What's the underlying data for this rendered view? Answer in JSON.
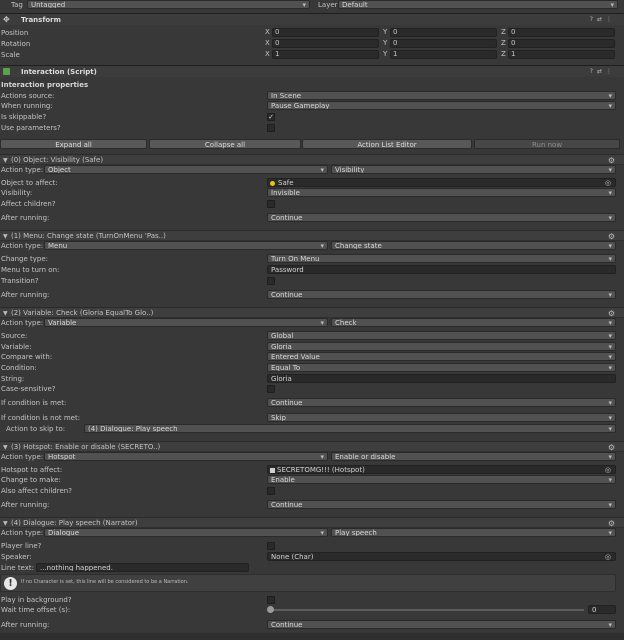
{
  "header": {
    "tag_label": "Tag",
    "tag_value": "Untagged",
    "layer_label": "Layer",
    "layer_value": "Default"
  },
  "transform": {
    "title": "Transform",
    "rows": [
      {
        "label": "Position",
        "x": "0",
        "y": "0",
        "z": "0"
      },
      {
        "label": "Rotation",
        "x": "0",
        "y": "0",
        "z": "0"
      },
      {
        "label": "Scale",
        "x": "1",
        "y": "1",
        "z": "1"
      }
    ],
    "axis": {
      "x": "X",
      "y": "Y",
      "z": "Z"
    }
  },
  "script": {
    "title": "Interaction (Script)",
    "props_title": "Interaction properties",
    "actions_source_label": "Actions source:",
    "actions_source": "In Scene",
    "when_running_label": "When running:",
    "when_running": "Pause Gameplay",
    "skippable_label": "Is skippable?",
    "skippable_checked": true,
    "use_params_label": "Use parameters?",
    "use_params_checked": false
  },
  "toolbar": {
    "expand": "Expand all",
    "collapse": "Collapse all",
    "editor": "Action List Editor",
    "run": "Run now"
  },
  "labels": {
    "action_type": "Action type:",
    "object_to_affect": "Object to affect:",
    "visibility": "Visibility:",
    "affect_children": "Affect children?",
    "after_running": "After running:",
    "change_type": "Change type:",
    "menu_to_turn_on": "Menu to turn on:",
    "transition": "Transition?",
    "source": "Source:",
    "variable": "Variable:",
    "compare_with": "Compare with:",
    "condition": "Condition:",
    "string": "String:",
    "case_sensitive": "Case-sensitive?",
    "if_met": "If condition is met:",
    "if_not_met": "If condition is not met:",
    "action_to_skip": "Action to skip to:",
    "hotspot_to_affect": "Hotspot to affect:",
    "change_to_make": "Change to make:",
    "also_affect_children": "Also affect children?",
    "player_line": "Player line?",
    "speaker": "Speaker:",
    "line_text": "Line text:",
    "play_bg": "Play in background?",
    "wait_offset": "Wait time offset (s):"
  },
  "actions": [
    {
      "title": "(0) Object: Visibility (Safe)",
      "type": "Object",
      "sub": "Visibility",
      "object": "Safe",
      "visibility": "Invisible",
      "after": "Continue"
    },
    {
      "title": "(1) Menu: Change state (TurnOnMenu 'Pas..)",
      "type": "Menu",
      "sub": "Change state",
      "change_type": "Turn On Menu",
      "menu": "Password",
      "after": "Continue"
    },
    {
      "title": "(2) Variable: Check (Gloria EqualTo Glo..)",
      "type": "Variable",
      "sub": "Check",
      "source": "Global",
      "variable": "Gloria",
      "compare": "Entered Value",
      "condition": "Equal To",
      "string": "Gloria",
      "met": "Continue",
      "not_met": "Skip",
      "skip_to": "(4) Dialogue: Play speech"
    },
    {
      "title": "(3) Hotspot: Enable or disable (SECRETO..)",
      "type": "Hotspot",
      "sub": "Enable or disable",
      "hotspot": "SECRETOMG!!! (Hotspot)",
      "change": "Enable",
      "after": "Continue"
    },
    {
      "title": "(4) Dialogue: Play speech (Narrator)",
      "type": "Dialogue",
      "sub": "Play speech",
      "speaker": "None (Char)",
      "line_text": "...nothing happened.",
      "help": "If no Character is set, this line will be considered to be a Narration.",
      "wait": "0",
      "after": "Continue"
    }
  ],
  "colors": {
    "background": "#383838",
    "field": "#2a2a2a",
    "dropdown": "#515151",
    "gold": "#e7c21a"
  }
}
